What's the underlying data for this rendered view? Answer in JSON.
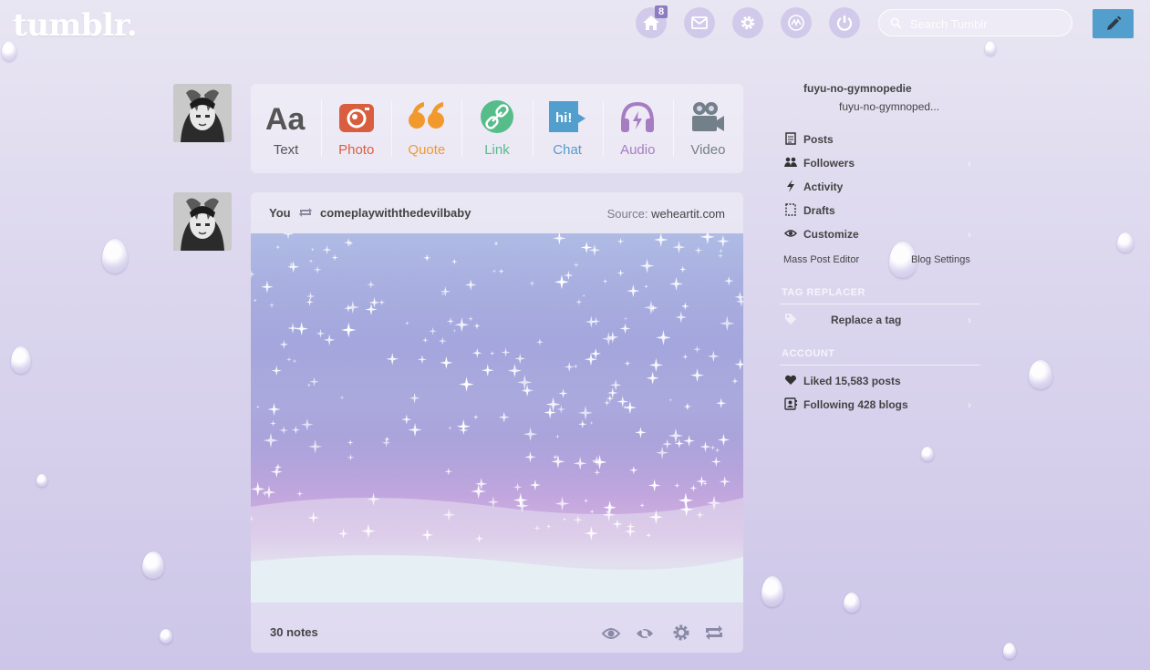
{
  "header": {
    "logo": "tumblr.",
    "dashboard_badge": "8",
    "search_placeholder": "Search Tumblr",
    "nav_icons": [
      "home-icon",
      "mail-icon",
      "gear-icon",
      "activity-icon",
      "power-icon"
    ],
    "compose_icon": "pencil-icon"
  },
  "post_types": [
    {
      "label": "Text",
      "icon": "text-aa-icon",
      "color": "#555555"
    },
    {
      "label": "Photo",
      "icon": "camera-icon",
      "color": "#d95e40"
    },
    {
      "label": "Quote",
      "icon": "quote-icon",
      "color": "#f2992e"
    },
    {
      "label": "Link",
      "icon": "link-icon",
      "color": "#56bc8a"
    },
    {
      "label": "Chat",
      "icon": "chat-icon",
      "color": "#529ecc"
    },
    {
      "label": "Audio",
      "icon": "headphones-icon",
      "color": "#a77dc2"
    },
    {
      "label": "Video",
      "icon": "video-camera-icon",
      "color": "#748089"
    }
  ],
  "post": {
    "author": "You",
    "reblogged_from": "comeplaywiththedevilbaby",
    "source_label": "Source:",
    "source_value": "weheartit.com",
    "notes": "30 notes",
    "actions": [
      "eye-icon",
      "eye-hidden-icon",
      "gear-icon",
      "reblog-icon"
    ]
  },
  "sidebar": {
    "blog_name": "fuyu-no-gymnopedie",
    "blog_title": "fuyu-no-gymnoped...",
    "items": [
      {
        "label": "Posts",
        "icon": "posts-icon"
      },
      {
        "label": "Followers",
        "icon": "followers-icon"
      },
      {
        "label": "Activity",
        "icon": "lightning-icon"
      },
      {
        "label": "Drafts",
        "icon": "drafts-icon"
      },
      {
        "label": "Customize",
        "icon": "eye-icon"
      }
    ],
    "mass_post_editor": "Mass Post Editor",
    "blog_settings": "Blog Settings",
    "tag_replacer_heading": "TAG REPLACER",
    "replace_tag": "Replace a tag",
    "account_heading": "ACCOUNT",
    "liked": "Liked 15,583 posts",
    "following": "Following 428 blogs"
  },
  "colors": {
    "accent": "#529ecc",
    "badge": "#8e7cc3",
    "background": "#dcd7ee"
  }
}
